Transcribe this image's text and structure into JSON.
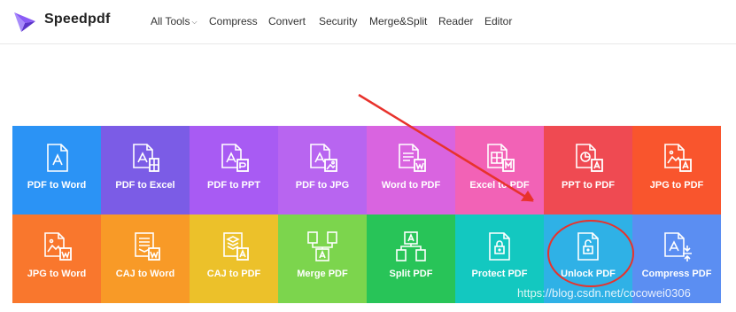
{
  "header": {
    "brand": "Speedpdf",
    "nav": [
      {
        "label": "All Tools",
        "caret": "⌵"
      },
      {
        "label": "Compress"
      },
      {
        "label": "Convert"
      },
      {
        "label": "Security"
      },
      {
        "label": "Merge&Split"
      },
      {
        "label": "Reader"
      },
      {
        "label": "Editor"
      }
    ]
  },
  "tools": [
    {
      "label": "PDF to Word",
      "color": "#2b93f5",
      "icon": "pdf-file-icon"
    },
    {
      "label": "PDF to Excel",
      "color": "#7b5ce6",
      "icon": "pdf-excel-icon"
    },
    {
      "label": "PDF to PPT",
      "color": "#a85bf3",
      "icon": "pdf-ppt-icon"
    },
    {
      "label": "PDF to JPG",
      "color": "#b865f0",
      "icon": "pdf-image-icon"
    },
    {
      "label": "Word to PDF",
      "color": "#d964e0",
      "icon": "word-document-icon"
    },
    {
      "label": "Excel to PDF",
      "color": "#f262b6",
      "icon": "excel-grid-icon"
    },
    {
      "label": "PPT to PDF",
      "color": "#ef4a52",
      "icon": "ppt-chart-icon"
    },
    {
      "label": "JPG to PDF",
      "color": "#f9552d",
      "icon": "image-pdf-icon"
    },
    {
      "label": "JPG to Word",
      "color": "#f9772d",
      "icon": "image-word-icon"
    },
    {
      "label": "CAJ to Word",
      "color": "#f89a27",
      "icon": "caj-stack-icon"
    },
    {
      "label": "CAJ to PDF",
      "color": "#ecc12a",
      "icon": "caj-layers-icon"
    },
    {
      "label": "Merge PDF",
      "color": "#7cd54d",
      "icon": "merge-icon"
    },
    {
      "label": "Split PDF",
      "color": "#28c458",
      "icon": "split-icon"
    },
    {
      "label": "Protect PDF",
      "color": "#13c8c0",
      "icon": "lock-icon"
    },
    {
      "label": "Unlock PDF",
      "color": "#2fb1e6",
      "icon": "unlock-icon"
    },
    {
      "label": "Compress PDF",
      "color": "#5b8ef2",
      "icon": "compress-icon"
    }
  ],
  "watermark": "https://blog.csdn.net/cocowei0306"
}
